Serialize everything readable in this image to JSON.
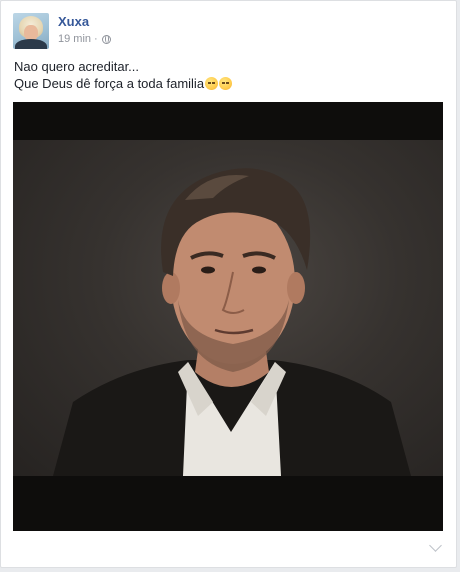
{
  "post": {
    "author": "Xuxa",
    "time": "19 min",
    "separator": "·",
    "privacy_icon": "globe-icon",
    "text_line1": "Nao quero acreditar...",
    "text_line2": "Que Deus dê força a toda familia",
    "emoji_icon": "sad-face-emoji-icon"
  },
  "colors": {
    "author_link": "#365899",
    "meta_gray": "#90949c",
    "text": "#1d2129",
    "page_bg": "#e9ebee"
  }
}
